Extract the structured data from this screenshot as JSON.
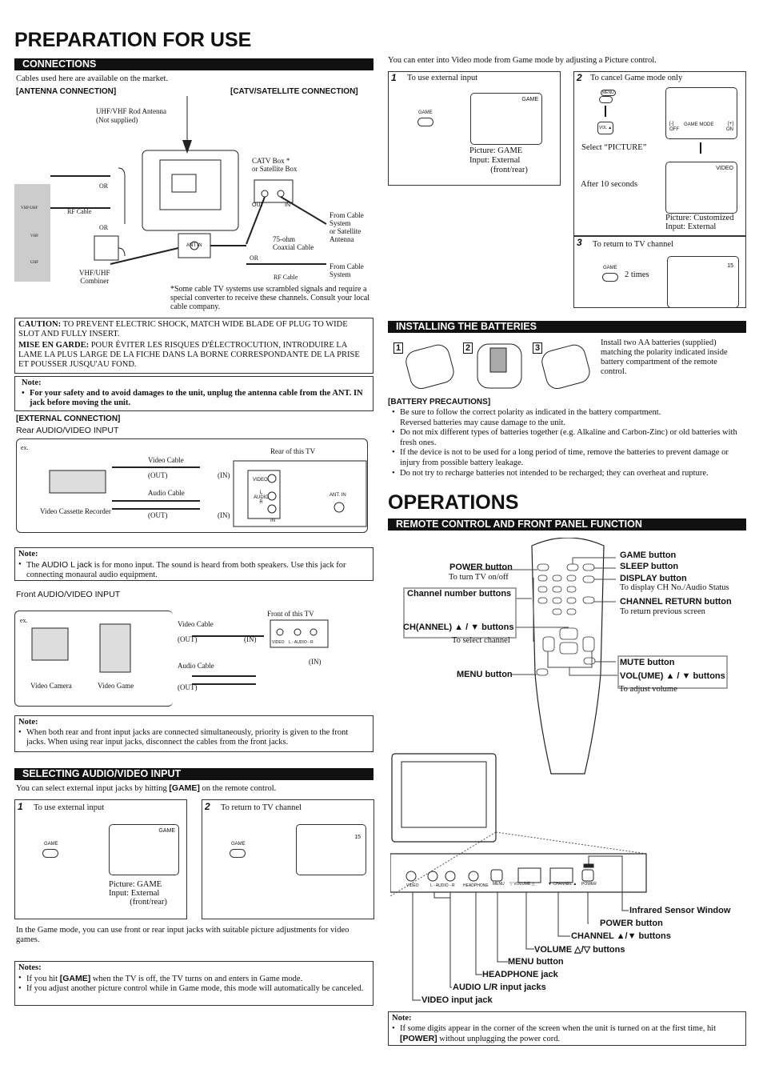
{
  "title": "PREPARATION FOR USE",
  "connections": {
    "header": "CONNECTIONS",
    "intro": "Cables used here are available on the market.",
    "antenna": "[ANTENNA CONNECTION]",
    "catv": "[CATV/SATELLITE CONNECTION]",
    "labels": {
      "rod": "UHF/VHF Rod Antenna",
      "not_supplied": "(Not supplied)",
      "or1": "OR",
      "or2": "OR",
      "or3": "OR",
      "rf": "RF Cable",
      "rf2": "RF Cable",
      "combiner": "VHF/UHF\nCombiner",
      "catvbox": "CATV Box *",
      "satbox": "or Satellite Box",
      "out": "OUT",
      "in": "IN",
      "antin": "ANT IN",
      "coax": "75-ohm\nCoaxial Cable",
      "from_cable": "From Cable\nSystem\nor Satellite\nAntenna",
      "from_cable2": "From Cable\nSystem",
      "vhfuhf": "VHF/UHF",
      "vhf": "VHF",
      "uhf": "UHF"
    },
    "footnote": "*Some cable TV systems use scrambled signals and require a special converter to receive these channels. Consult your local cable company.",
    "caution_label": "CAUTION:",
    "caution": "TO PREVENT ELECTRIC SHOCK, MATCH WIDE BLADE OF PLUG TO WIDE SLOT AND FULLY INSERT.",
    "mise_label": "MISE EN GARDE:",
    "mise": "POUR ÉVITER LES RISQUES D'ÉLECTROCUTION, INTRODUIRE LA LAME LA PLUS LARGE DE LA FICHE DANS LA BORNE CORRESPONDANTE DE LA PRISE ET POUSSER JUSQU'AU FOND.",
    "note_label": "Note:",
    "note": "For your safety and to avoid damages to the unit, unplug the antenna cable from the ANT. IN jack before moving the unit."
  },
  "external": {
    "header": "[EXTERNAL CONNECTION]",
    "rear_title": "Rear AUDIO/VIDEO INPUT",
    "rear": {
      "ex": "ex.",
      "video_cable": "Video Cable",
      "out1": "(OUT)",
      "in1": "(IN)",
      "audio_cable": "Audio Cable",
      "out2": "(OUT)",
      "in2": "(IN)",
      "vcr": "Video Cassette Recorder",
      "rear_tv": "Rear of this TV",
      "video": "VIDEO",
      "audio": "L\nAUDIO\nR",
      "in": "IN",
      "antin": "ANT. IN"
    },
    "note1_label": "Note:",
    "note1_pre": "The ",
    "note1_jack": "AUDIO L jack",
    "note1_post": " is for mono input. The sound is heard from both speakers. Use this jack for connecting monaural audio equipment.",
    "front_title": "Front AUDIO/VIDEO INPUT",
    "front": {
      "ex": "ex.",
      "video_cable": "Video Cable",
      "out1": "(OUT)",
      "in1": "(IN)",
      "audio_cable": "Audio Cable",
      "out2": "(OUT)",
      "in2": "(IN)",
      "front_tv": "Front of this TV",
      "camera": "Video Camera",
      "game": "Video Game",
      "jacks": "VIDEO    L - AUDIO - R"
    },
    "note2_label": "Note:",
    "note2": "When both rear and front input jacks are connected simultaneously, priority is given to the front jacks. When using rear input jacks, disconnect the cables from the front jacks."
  },
  "selecting": {
    "header": "SELECTING AUDIO/VIDEO INPUT",
    "intro_pre": "You can select external input jacks by hitting ",
    "intro_key": "[GAME]",
    "intro_post": " on the remote control.",
    "step1": {
      "num": "1",
      "title": "To use external input",
      "btn": "GAME",
      "screen": "GAME",
      "caption": "Picture: GAME\nInput: External\n          (front/rear)"
    },
    "step2": {
      "num": "2",
      "title": "To return to TV channel",
      "btn": "GAME",
      "screen": "15"
    },
    "game_mode_text": "In the Game mode, you can use front or rear input jacks with suitable picture adjustments for video games.",
    "notes_label": "Notes:",
    "notes": [
      {
        "pre": "If you hit ",
        "key": "[GAME]",
        "post": " when the TV is off, the TV turns on and enters in Game mode."
      },
      {
        "pre": "If you adjust another picture control while in Game mode, this mode will automatically be canceled.",
        "key": "",
        "post": ""
      }
    ]
  },
  "video_mode": {
    "intro": "You can enter into Video mode from Game mode by adjusting a Picture control.",
    "step1": {
      "num": "1",
      "title": "To use external input",
      "btn": "GAME",
      "screen": "GAME",
      "caption": "Picture: GAME\nInput: External\n          (front/rear)"
    },
    "step2": {
      "num": "2",
      "title": "To cancel Game mode only",
      "menu": "MENU",
      "vol": "VOL ▲",
      "select": "Select “PICTURE”",
      "screen_minus": "[-]\nOFF",
      "screen_mode": "GAME MODE",
      "screen_plus": "[+]\nON",
      "after": "After 10 seconds",
      "screen2": "VIDEO",
      "caption": "Picture: Customized\nInput: External"
    },
    "step3": {
      "num": "3",
      "title": "To return to TV channel",
      "btn": "GAME",
      "times": "2 times",
      "screen": "15"
    }
  },
  "batteries": {
    "header": "INSTALLING THE BATTERIES",
    "steps": [
      "1",
      "2",
      "3"
    ],
    "text": "Install two AA batteries (supplied) matching the polarity indicated inside battery compartment of the remote control.",
    "precautions_title": "[BATTERY PRECAUTIONS]",
    "precautions": [
      "Be sure to follow the correct polarity as indicated in the battery compartment.\nReversed batteries may cause damage to the unit.",
      "Do not mix different types of batteries together (e.g. Alkaline and Carbon-Zinc) or old batteries with fresh ones.",
      "If the device is not to be used for a long period of time, remove the batteries to prevent damage or injury from possible battery leakage.",
      "Do not try to recharge batteries not intended to be recharged; they can overheat and rupture."
    ]
  },
  "operations": {
    "title": "OPERATIONS",
    "header": "REMOTE CONTROL AND FRONT PANEL FUNCTION",
    "remote": {
      "power": "POWER button",
      "power_sub": "To turn TV on/off",
      "channel_num": "Channel number buttons",
      "ch": "CH(ANNEL) ▲ / ▼ buttons",
      "ch_sub": "To select channel",
      "menu": "MENU button",
      "game": "GAME button",
      "sleep": "SLEEP button",
      "display": "DISPLAY button",
      "display_sub": "To display CH No./Audio Status",
      "chreturn": "CHANNEL RETURN button",
      "chreturn_sub": "To return previous screen",
      "mute": "MUTE button",
      "vol": "VOL(UME) ▲ / ▼ buttons",
      "vol_sub": "To adjust volume"
    },
    "panel": {
      "video": "VIDEO",
      "audio": "L - AUDIO - R",
      "headphone": "HEADPHONE",
      "menu": "MENU",
      "volume": "▽ VOLUME △",
      "channel": "▼ CHANNEL ▲",
      "power": "POWER",
      "labels": [
        "Infrared Sensor Window",
        "POWER button",
        "CHANNEL ▲/▼ buttons",
        "VOLUME △/▽ buttons",
        "MENU button",
        "HEADPHONE jack",
        "AUDIO L/R input jacks",
        "VIDEO input jack"
      ]
    },
    "note_label": "Note:",
    "note_pre": "If some digits appear in the corner of the screen when the unit is turned on at the first time, hit ",
    "note_key": "[POWER]",
    "note_post": " without unplugging the power cord."
  }
}
